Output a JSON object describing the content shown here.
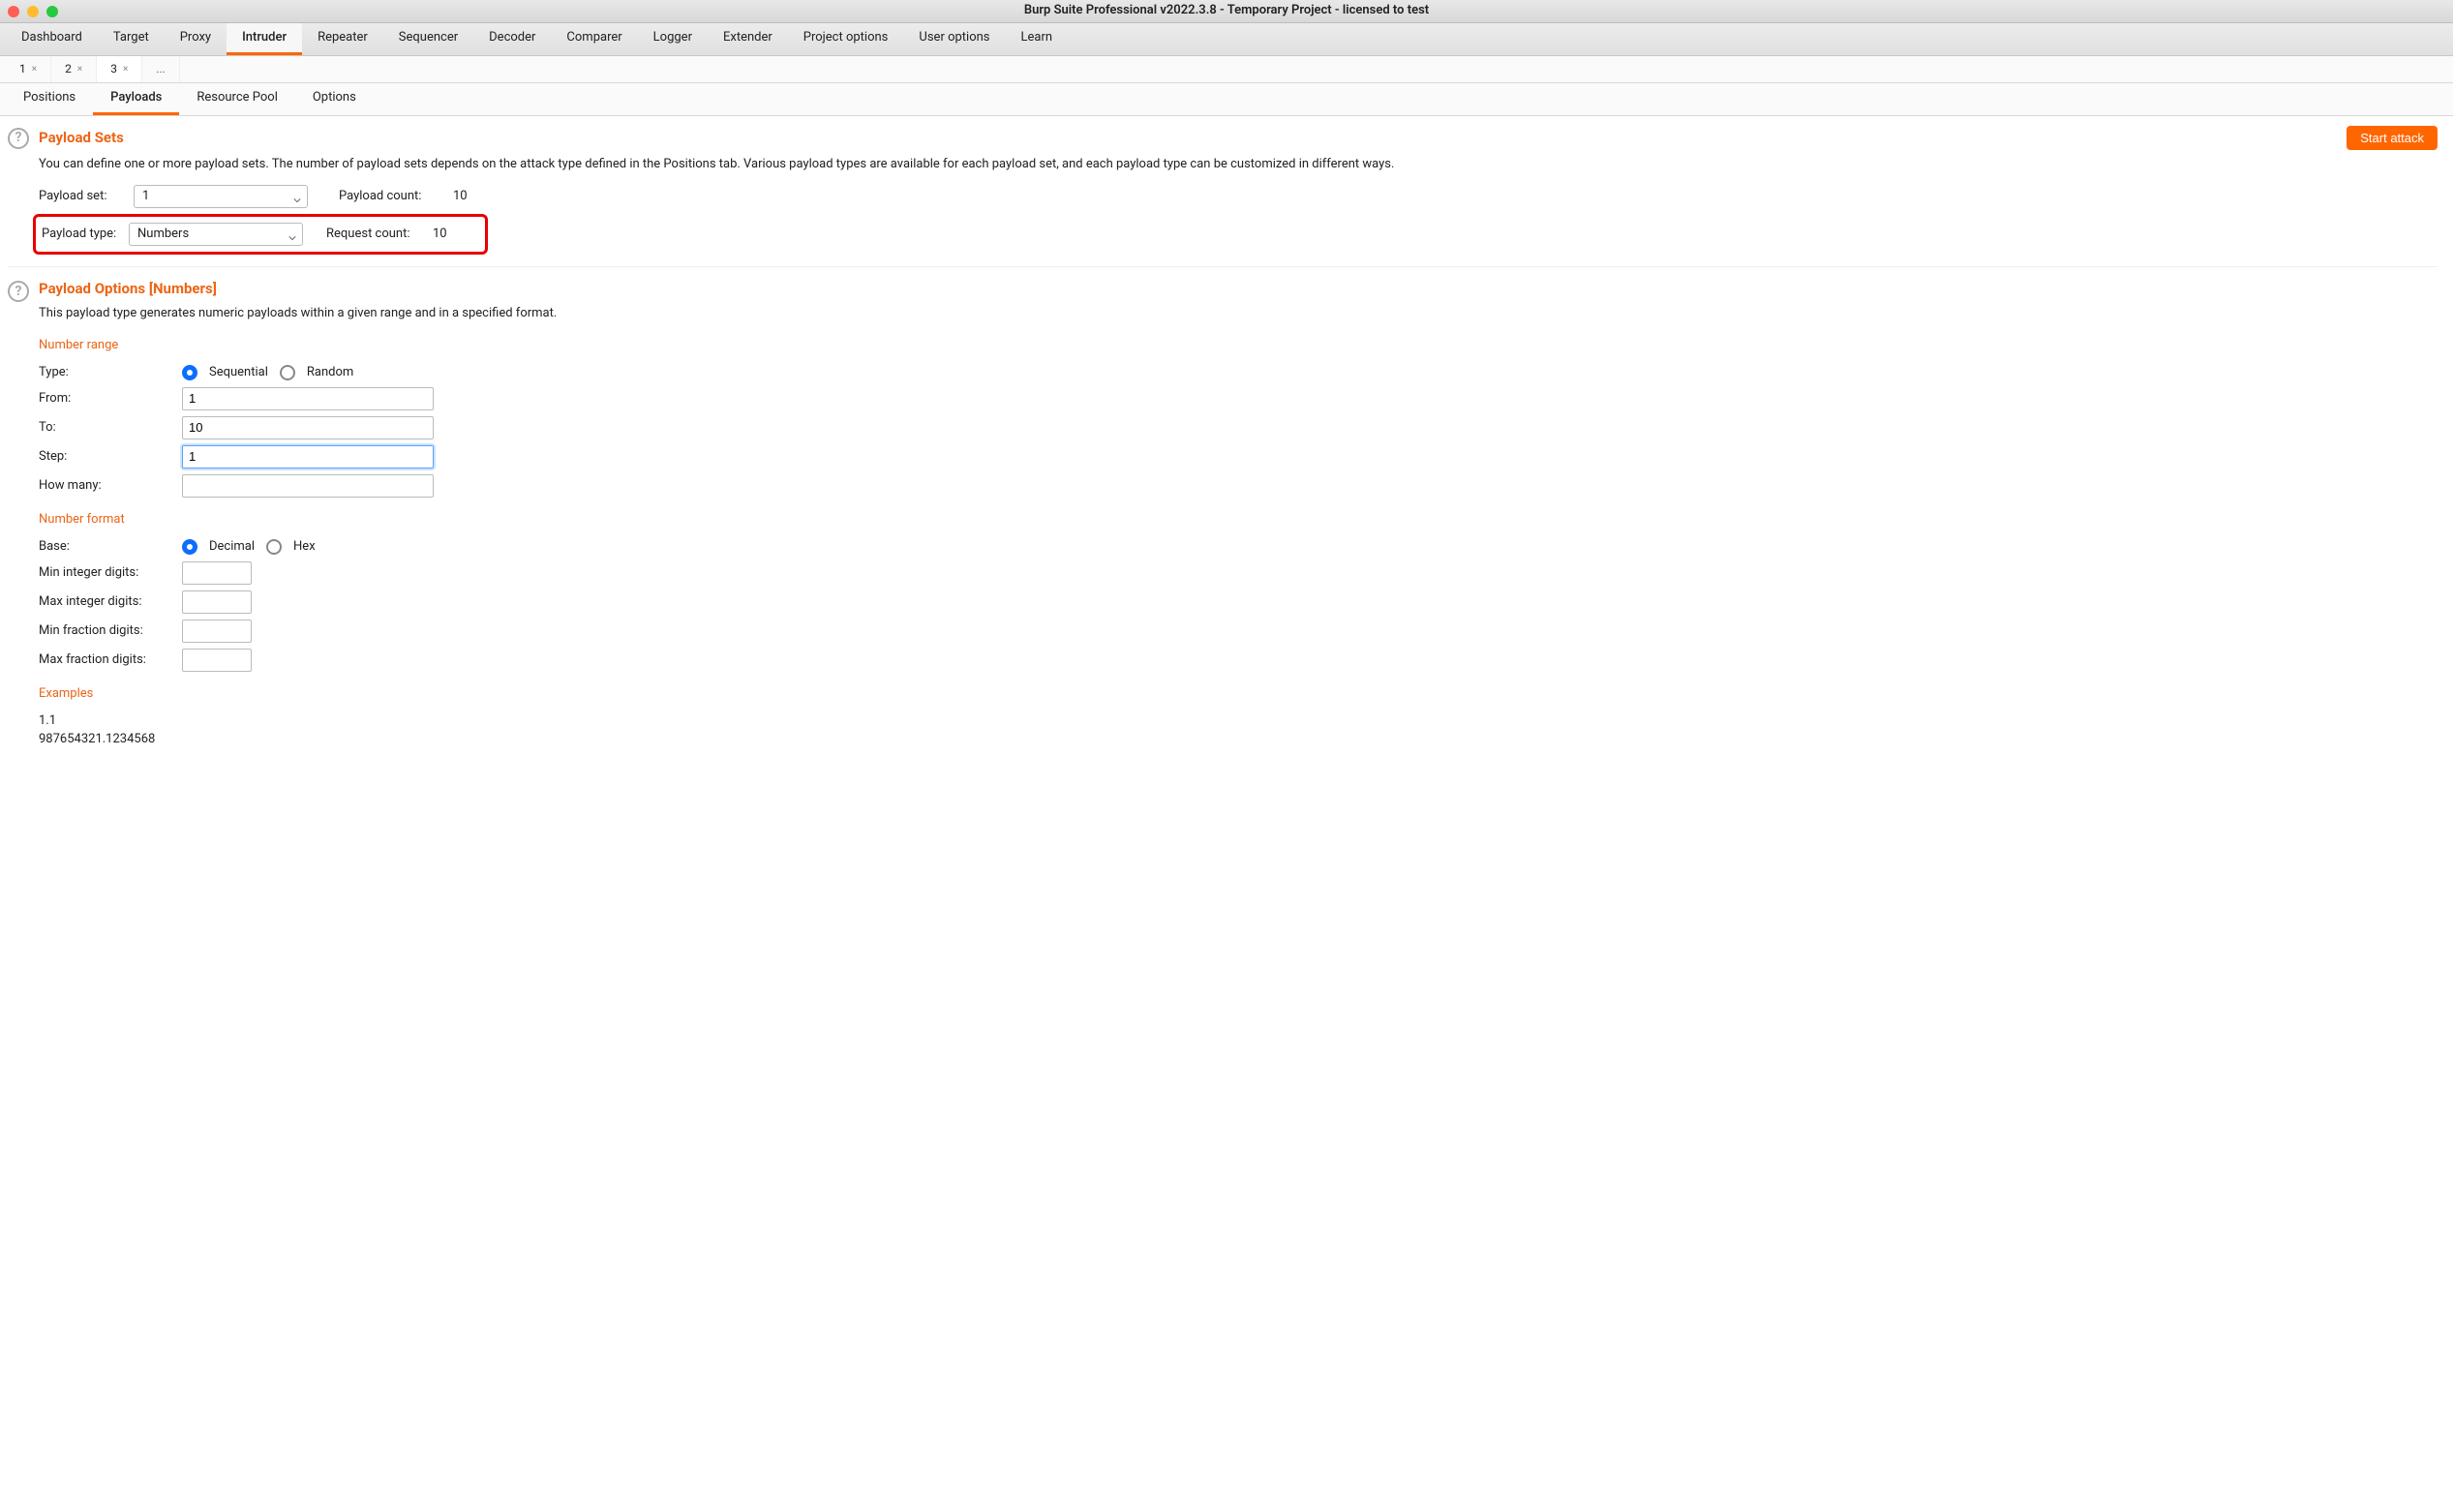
{
  "window": {
    "title": "Burp Suite Professional v2022.3.8 - Temporary Project - licensed to test"
  },
  "mainTabs": {
    "items": [
      {
        "label": "Dashboard"
      },
      {
        "label": "Target"
      },
      {
        "label": "Proxy"
      },
      {
        "label": "Intruder",
        "active": true
      },
      {
        "label": "Repeater"
      },
      {
        "label": "Sequencer"
      },
      {
        "label": "Decoder"
      },
      {
        "label": "Comparer"
      },
      {
        "label": "Logger"
      },
      {
        "label": "Extender"
      },
      {
        "label": "Project options"
      },
      {
        "label": "User options"
      },
      {
        "label": "Learn"
      }
    ]
  },
  "attackTabs": {
    "items": [
      {
        "label": "1"
      },
      {
        "label": "2"
      },
      {
        "label": "3",
        "active": true
      }
    ],
    "ellipsis": "..."
  },
  "intruderTabs": {
    "items": [
      {
        "label": "Positions"
      },
      {
        "label": "Payloads",
        "active": true
      },
      {
        "label": "Resource Pool"
      },
      {
        "label": "Options"
      }
    ]
  },
  "payloadSets": {
    "title": "Payload Sets",
    "start_button": "Start attack",
    "description": "You can define one or more payload sets. The number of payload sets depends on the attack type defined in the Positions tab. Various payload types are available for each payload set, and each payload type can be customized in different ways.",
    "set_label": "Payload set:",
    "set_value": "1",
    "payload_count_label": "Payload count:",
    "payload_count_value": "10",
    "type_label": "Payload type:",
    "type_value": "Numbers",
    "request_count_label": "Request count:",
    "request_count_value": "10"
  },
  "payloadOptions": {
    "title": "Payload Options [Numbers]",
    "description": "This payload type generates numeric payloads within a given range and in a specified format.",
    "range_heading": "Number range",
    "type_label": "Type:",
    "radio_sequential": "Sequential",
    "radio_random": "Random",
    "from_label": "From:",
    "from_value": "1",
    "to_label": "To:",
    "to_value": "10",
    "step_label": "Step:",
    "step_value": "1",
    "howmany_label": "How many:",
    "howmany_value": "",
    "format_heading": "Number format",
    "base_label": "Base:",
    "radio_decimal": "Decimal",
    "radio_hex": "Hex",
    "min_int_label": "Min integer digits:",
    "max_int_label": "Max integer digits:",
    "min_frac_label": "Min fraction digits:",
    "max_frac_label": "Max fraction digits:",
    "min_int_value": "",
    "max_int_value": "",
    "min_frac_value": "",
    "max_frac_value": "",
    "examples_heading": "Examples",
    "example1": "1.1",
    "example2": "987654321.1234568"
  }
}
